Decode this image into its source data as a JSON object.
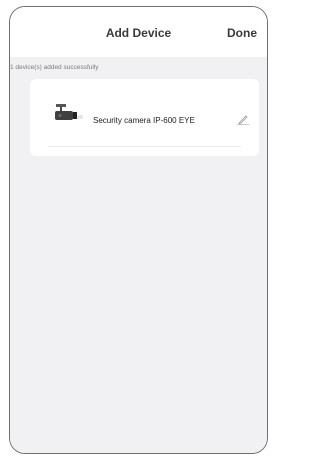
{
  "nav": {
    "title": "Add Device",
    "done_label": "Done"
  },
  "status": {
    "message": "1 device(s) added successfully"
  },
  "device": {
    "name": "Security camera IP-600 EYE",
    "icon": "security-camera-icon"
  },
  "colors": {
    "background": "#f1f1f3",
    "card": "#ffffff",
    "text": "#3a3a3a",
    "frame": "#6f6f6f"
  }
}
